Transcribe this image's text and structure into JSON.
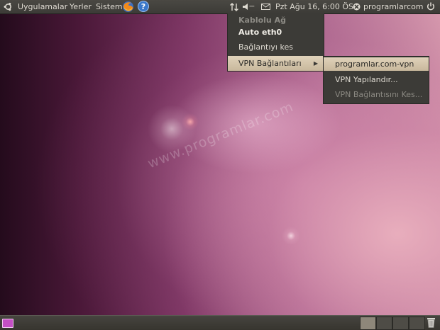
{
  "top_panel": {
    "menus": [
      "Uygulamalar",
      "Yerler",
      "Sistem"
    ],
    "volume_dashes": "---",
    "clock": "Pzt Ağu 16,  6:00 ÖS",
    "username": "programlarcom"
  },
  "network_menu": {
    "header": "Kablolu Ağ",
    "connection": "Auto eth0",
    "disconnect": "Bağlantıyı kes",
    "vpn": "VPN Bağlantıları"
  },
  "vpn_submenu": {
    "items": [
      "programlar.com-vpn",
      "VPN Yapılandır...",
      "VPN Bağlantısını Kes..."
    ]
  },
  "watermark": "www.programlar.com",
  "icons": {
    "top": [
      "ubuntu-logo-icon",
      "firefox-icon",
      "help-icon",
      "network-icon",
      "volume-icon",
      "mail-icon",
      "user-status-icon",
      "power-icon"
    ],
    "bottom": [
      "show-desktop-icon",
      "trash-icon"
    ]
  },
  "colors": {
    "panel": "#3c3b37",
    "menu_highlight": "#d9c9ad"
  }
}
